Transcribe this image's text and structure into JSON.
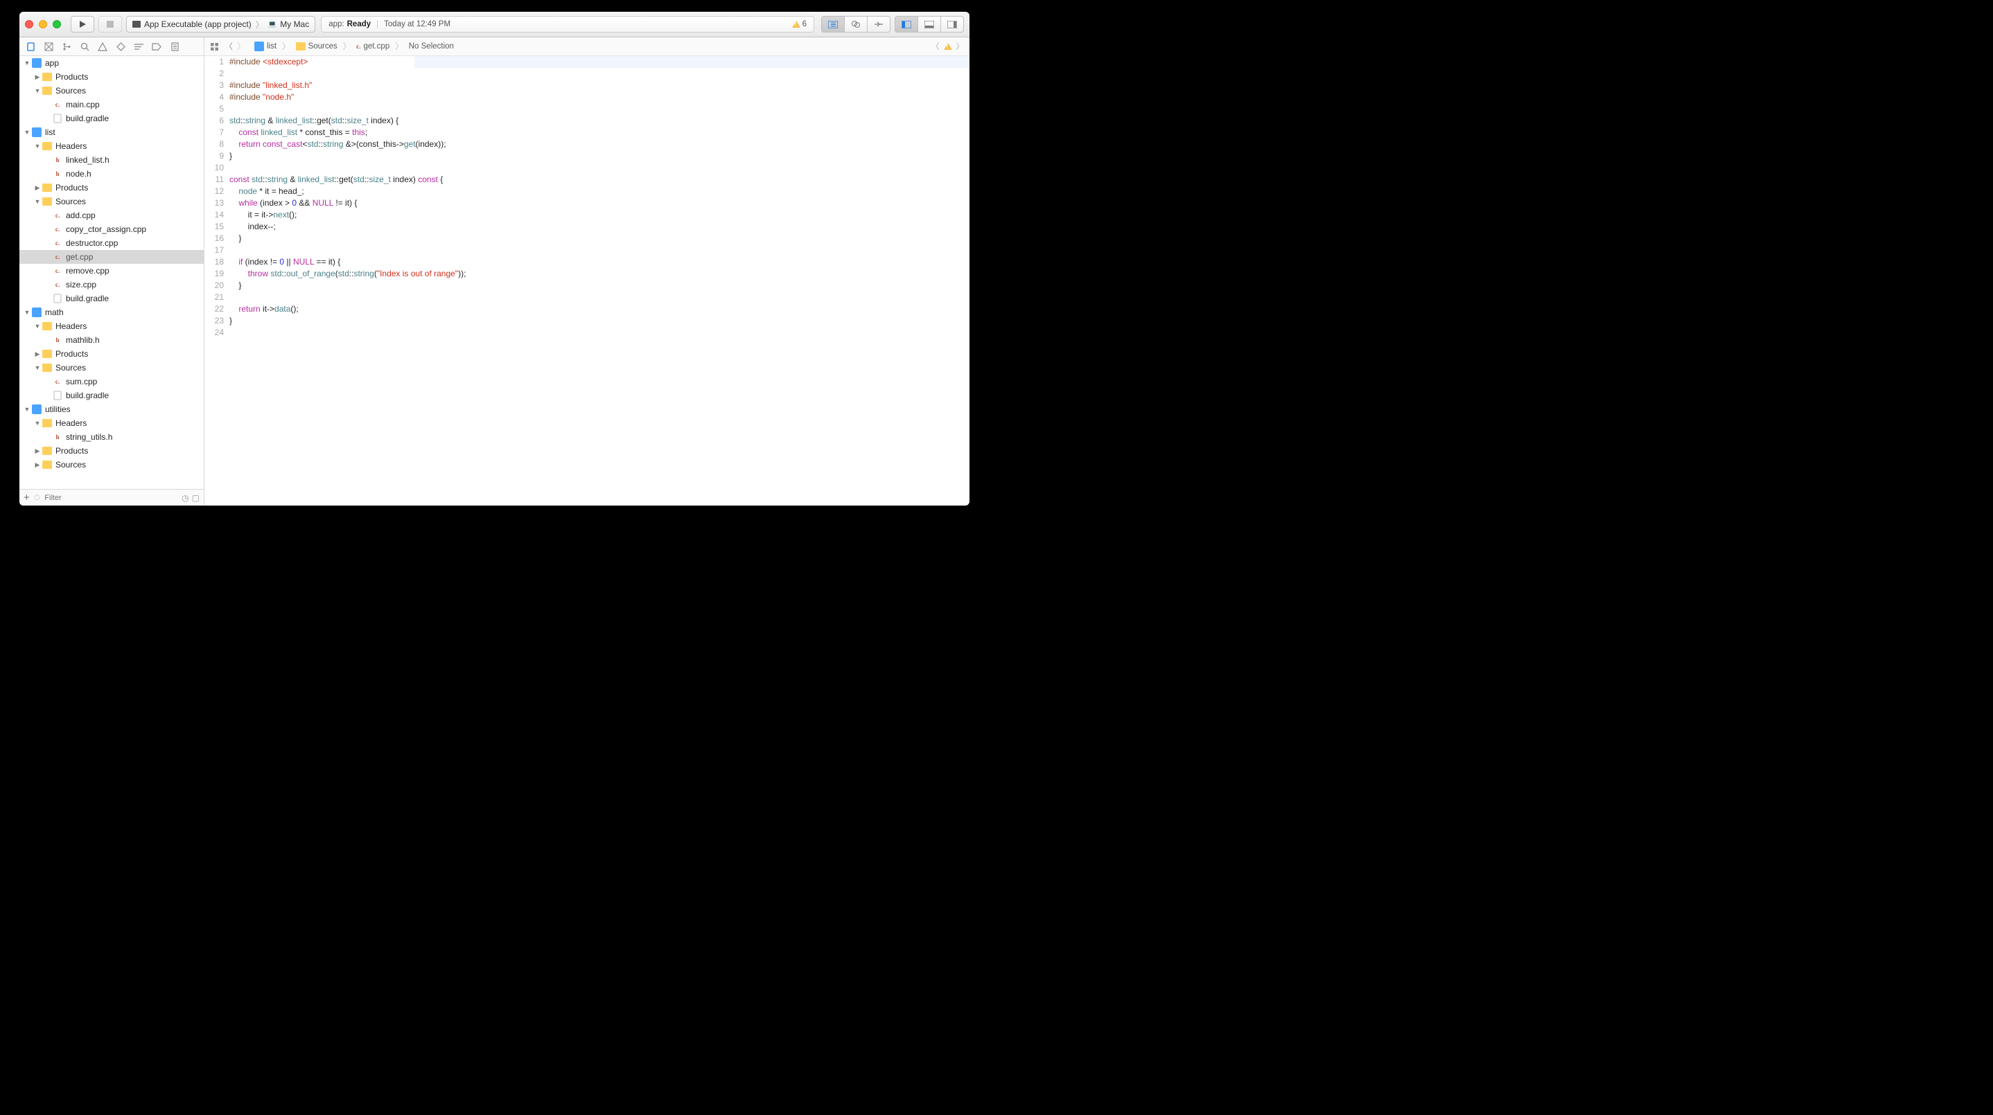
{
  "toolbar": {
    "scheme_target": "App Executable (app project)",
    "scheme_device": "My Mac",
    "status_app": "app:",
    "status_state": "Ready",
    "status_time": "Today at 12:49 PM",
    "warning_count": "6"
  },
  "nav": {
    "filter_placeholder": "Filter",
    "tree": [
      {
        "d": 0,
        "k": "proj",
        "t": "app",
        "open": true
      },
      {
        "d": 1,
        "k": "folder",
        "t": "Products",
        "open": false
      },
      {
        "d": 1,
        "k": "folder",
        "t": "Sources",
        "open": true
      },
      {
        "d": 2,
        "k": "cpp",
        "t": "main.cpp"
      },
      {
        "d": 2,
        "k": "file",
        "t": "build.gradle"
      },
      {
        "d": 0,
        "k": "proj",
        "t": "list",
        "open": true
      },
      {
        "d": 1,
        "k": "folder",
        "t": "Headers",
        "open": true
      },
      {
        "d": 2,
        "k": "h",
        "t": "linked_list.h"
      },
      {
        "d": 2,
        "k": "h",
        "t": "node.h"
      },
      {
        "d": 1,
        "k": "folder",
        "t": "Products",
        "open": false
      },
      {
        "d": 1,
        "k": "folder",
        "t": "Sources",
        "open": true
      },
      {
        "d": 2,
        "k": "cpp",
        "t": "add.cpp"
      },
      {
        "d": 2,
        "k": "cpp",
        "t": "copy_ctor_assign.cpp"
      },
      {
        "d": 2,
        "k": "cpp",
        "t": "destructor.cpp"
      },
      {
        "d": 2,
        "k": "cpp",
        "t": "get.cpp",
        "sel": true
      },
      {
        "d": 2,
        "k": "cpp",
        "t": "remove.cpp"
      },
      {
        "d": 2,
        "k": "cpp",
        "t": "size.cpp"
      },
      {
        "d": 2,
        "k": "file",
        "t": "build.gradle"
      },
      {
        "d": 0,
        "k": "proj",
        "t": "math",
        "open": true
      },
      {
        "d": 1,
        "k": "folder",
        "t": "Headers",
        "open": true
      },
      {
        "d": 2,
        "k": "h",
        "t": "mathlib.h"
      },
      {
        "d": 1,
        "k": "folder",
        "t": "Products",
        "open": false
      },
      {
        "d": 1,
        "k": "folder",
        "t": "Sources",
        "open": true
      },
      {
        "d": 2,
        "k": "cpp",
        "t": "sum.cpp"
      },
      {
        "d": 2,
        "k": "file",
        "t": "build.gradle"
      },
      {
        "d": 0,
        "k": "proj",
        "t": "utilities",
        "open": true
      },
      {
        "d": 1,
        "k": "folder",
        "t": "Headers",
        "open": true
      },
      {
        "d": 2,
        "k": "h",
        "t": "string_utils.h"
      },
      {
        "d": 1,
        "k": "folder",
        "t": "Products",
        "open": false
      },
      {
        "d": 1,
        "k": "folder",
        "t": "Sources",
        "open": false
      }
    ]
  },
  "jumpbar": {
    "crumbs": [
      "list",
      "Sources",
      "get.cpp",
      "No Selection"
    ]
  },
  "code": {
    "lines": [
      [
        {
          "c": "pre",
          "t": "#include "
        },
        {
          "c": "str",
          "t": "<stdexcept>"
        }
      ],
      [],
      [
        {
          "c": "pre",
          "t": "#include "
        },
        {
          "c": "str",
          "t": "\"linked_list.h\""
        }
      ],
      [
        {
          "c": "pre",
          "t": "#include "
        },
        {
          "c": "str",
          "t": "\"node.h\""
        }
      ],
      [],
      [
        {
          "c": "typ",
          "t": "std"
        },
        {
          "c": "op",
          "t": "::"
        },
        {
          "c": "typ",
          "t": "string"
        },
        {
          "c": "op",
          "t": " & "
        },
        {
          "c": "fn",
          "t": "linked_list"
        },
        {
          "c": "op",
          "t": "::get("
        },
        {
          "c": "typ",
          "t": "std"
        },
        {
          "c": "op",
          "t": "::"
        },
        {
          "c": "typ",
          "t": "size_t"
        },
        {
          "c": "op",
          "t": " index) {"
        }
      ],
      [
        {
          "c": "op",
          "t": "    "
        },
        {
          "c": "kw",
          "t": "const"
        },
        {
          "c": "op",
          "t": " "
        },
        {
          "c": "fn",
          "t": "linked_list"
        },
        {
          "c": "op",
          "t": " * const_this = "
        },
        {
          "c": "kw",
          "t": "this"
        },
        {
          "c": "op",
          "t": ";"
        }
      ],
      [
        {
          "c": "op",
          "t": "    "
        },
        {
          "c": "kw",
          "t": "return"
        },
        {
          "c": "op",
          "t": " "
        },
        {
          "c": "kw",
          "t": "const_cast"
        },
        {
          "c": "op",
          "t": "<"
        },
        {
          "c": "typ",
          "t": "std"
        },
        {
          "c": "op",
          "t": "::"
        },
        {
          "c": "typ",
          "t": "string"
        },
        {
          "c": "op",
          "t": " &>(const_this->"
        },
        {
          "c": "fn",
          "t": "get"
        },
        {
          "c": "op",
          "t": "(index));"
        }
      ],
      [
        {
          "c": "op",
          "t": "}"
        }
      ],
      [],
      [
        {
          "c": "kw",
          "t": "const"
        },
        {
          "c": "op",
          "t": " "
        },
        {
          "c": "typ",
          "t": "std"
        },
        {
          "c": "op",
          "t": "::"
        },
        {
          "c": "typ",
          "t": "string"
        },
        {
          "c": "op",
          "t": " & "
        },
        {
          "c": "fn",
          "t": "linked_list"
        },
        {
          "c": "op",
          "t": "::get("
        },
        {
          "c": "typ",
          "t": "std"
        },
        {
          "c": "op",
          "t": "::"
        },
        {
          "c": "typ",
          "t": "size_t"
        },
        {
          "c": "op",
          "t": " index) "
        },
        {
          "c": "kw",
          "t": "const"
        },
        {
          "c": "op",
          "t": " {"
        }
      ],
      [
        {
          "c": "op",
          "t": "    "
        },
        {
          "c": "fn",
          "t": "node"
        },
        {
          "c": "op",
          "t": " * it = head_;"
        }
      ],
      [
        {
          "c": "op",
          "t": "    "
        },
        {
          "c": "kw",
          "t": "while"
        },
        {
          "c": "op",
          "t": " (index > "
        },
        {
          "c": "num",
          "t": "0"
        },
        {
          "c": "op",
          "t": " && "
        },
        {
          "c": "kw",
          "t": "NULL"
        },
        {
          "c": "op",
          "t": " != it) {"
        }
      ],
      [
        {
          "c": "op",
          "t": "        it = it->"
        },
        {
          "c": "fn",
          "t": "next"
        },
        {
          "c": "op",
          "t": "();"
        }
      ],
      [
        {
          "c": "op",
          "t": "        index--;"
        }
      ],
      [
        {
          "c": "op",
          "t": "    }"
        }
      ],
      [],
      [
        {
          "c": "op",
          "t": "    "
        },
        {
          "c": "kw",
          "t": "if"
        },
        {
          "c": "op",
          "t": " (index != "
        },
        {
          "c": "num",
          "t": "0"
        },
        {
          "c": "op",
          "t": " || "
        },
        {
          "c": "kw",
          "t": "NULL"
        },
        {
          "c": "op",
          "t": " == it) {"
        }
      ],
      [
        {
          "c": "op",
          "t": "        "
        },
        {
          "c": "kw",
          "t": "throw"
        },
        {
          "c": "op",
          "t": " "
        },
        {
          "c": "typ",
          "t": "std"
        },
        {
          "c": "op",
          "t": "::"
        },
        {
          "c": "fn",
          "t": "out_of_range"
        },
        {
          "c": "op",
          "t": "("
        },
        {
          "c": "typ",
          "t": "std"
        },
        {
          "c": "op",
          "t": "::"
        },
        {
          "c": "fn",
          "t": "string"
        },
        {
          "c": "op",
          "t": "("
        },
        {
          "c": "str",
          "t": "\"Index is out of range\""
        },
        {
          "c": "op",
          "t": "));"
        }
      ],
      [
        {
          "c": "op",
          "t": "    }"
        }
      ],
      [],
      [
        {
          "c": "op",
          "t": "    "
        },
        {
          "c": "kw",
          "t": "return"
        },
        {
          "c": "op",
          "t": " it->"
        },
        {
          "c": "fn",
          "t": "data"
        },
        {
          "c": "op",
          "t": "();"
        }
      ],
      [
        {
          "c": "op",
          "t": "}"
        }
      ],
      []
    ]
  }
}
